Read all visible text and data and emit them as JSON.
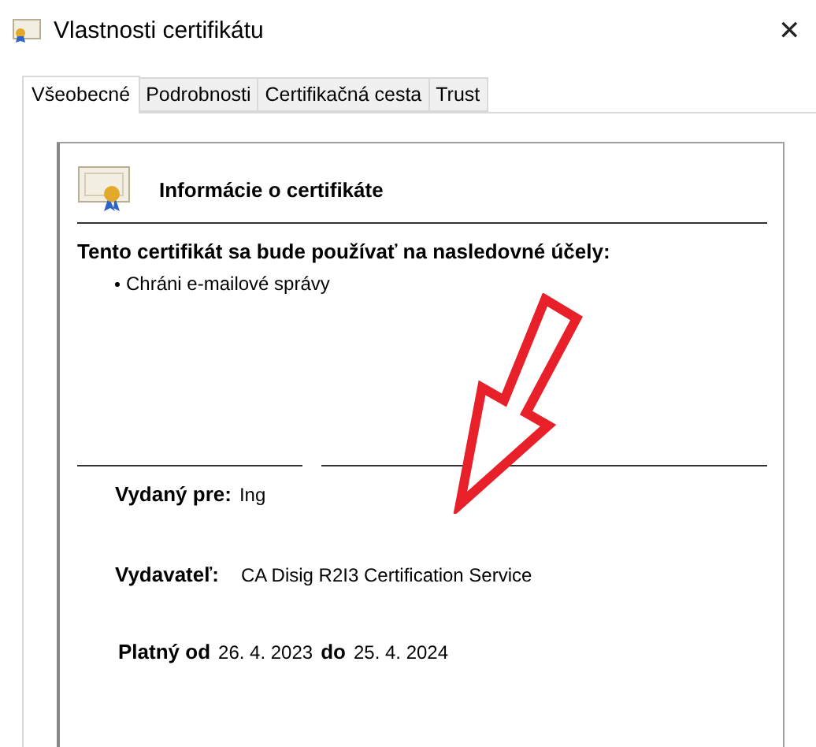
{
  "window": {
    "title": "Vlastnosti certifikátu",
    "close": "✕"
  },
  "tabs": [
    {
      "label": "Všeobecné",
      "selected": true
    },
    {
      "label": "Podrobnosti",
      "selected": false
    },
    {
      "label": "Certifikačná cesta",
      "selected": false
    },
    {
      "label": "Trust",
      "selected": false
    }
  ],
  "info": {
    "heading": "Informácie o certifikáte",
    "purpose_title": "Tento certifikát sa bude používať na nasledovné účely:",
    "purposes": [
      "Chráni e-mailové správy"
    ],
    "issued_to": {
      "label": "Vydaný pre:",
      "value": "Ing"
    },
    "issued_by": {
      "label": "Vydavateľ:",
      "value": "CA Disig R2I3 Certification Service"
    },
    "validity": {
      "from_label": "Platný od",
      "from": "26. 4. 2023",
      "to_label": "do",
      "to": "25. 4. 2024"
    }
  }
}
